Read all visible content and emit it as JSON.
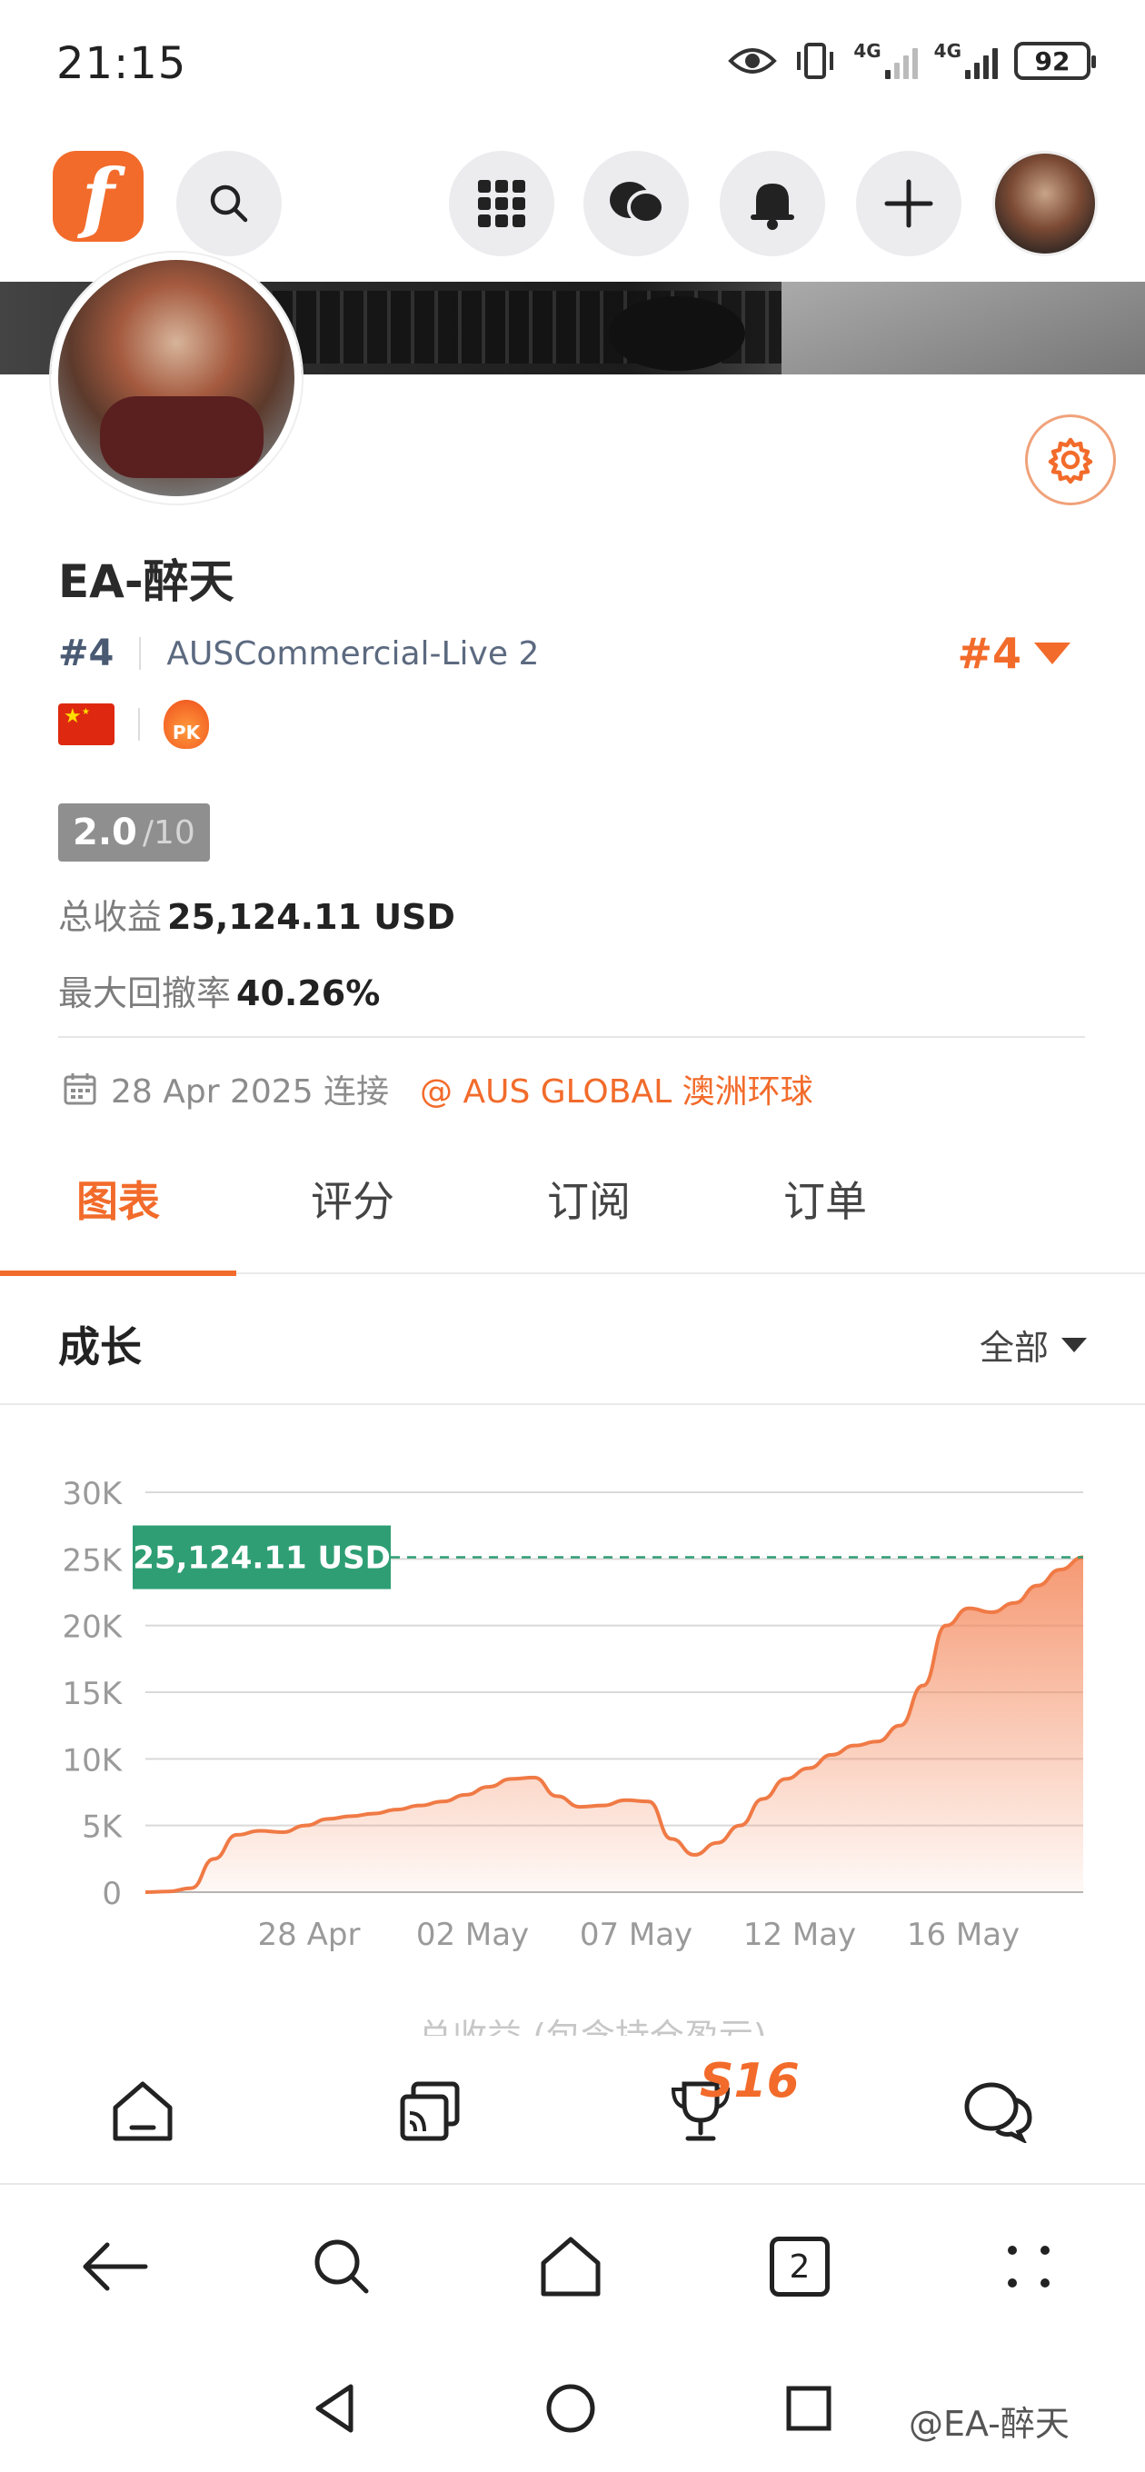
{
  "status_bar": {
    "time": "21:15",
    "network_1": "4G",
    "network_2": "4G",
    "battery": "92"
  },
  "profile": {
    "name": "EA-醉天",
    "rank": "#4",
    "server": "AUSCommercial-Live 2",
    "rank_right": "#4",
    "pk_badge": "PK",
    "score": "2.0",
    "score_max": "/10",
    "total_profit_label": "总收益",
    "total_profit_value": "25,124.11 USD",
    "max_drawdown_label": "最大回撤率",
    "max_drawdown_value": "40.26%",
    "connect_date": "28 Apr 2025 连接",
    "broker": "@ AUS GLOBAL 澳洲环球"
  },
  "tabs": [
    {
      "label": "图表",
      "active": true
    },
    {
      "label": "评分",
      "active": false
    },
    {
      "label": "订阅",
      "active": false
    },
    {
      "label": "订单",
      "active": false
    }
  ],
  "section": {
    "title": "成长",
    "filter": "全部"
  },
  "chart_data": {
    "type": "area",
    "title": "",
    "xlabel": "",
    "ylabel": "",
    "ylim": [
      0,
      30000
    ],
    "y_ticks": [
      "0",
      "5K",
      "10K",
      "15K",
      "20K",
      "25K",
      "30K"
    ],
    "x_ticks": [
      "28 Apr",
      "02 May",
      "07 May",
      "12 May",
      "16 May"
    ],
    "current_value_label": "25,124.11 USD",
    "current_value": 25124.11,
    "series": [
      {
        "values": [
          0,
          50,
          300,
          2500,
          4300,
          4600,
          4500,
          5000,
          5500,
          5700,
          5900,
          6200,
          6500,
          6800,
          7300,
          7900,
          8500,
          8600,
          7200,
          6400,
          6500,
          6900,
          6800,
          4000,
          2800,
          3700,
          5000,
          7000,
          8500,
          9300,
          10300,
          11000,
          11300,
          12500,
          15500,
          20000,
          21300,
          21000,
          21700,
          23000,
          24200,
          25124
        ]
      }
    ],
    "grid": true,
    "fill_color": "#f4875a",
    "line_color": "#f07a45",
    "label_color": "#2f9e74"
  },
  "bottom_cut_label": "总收益 (包含持仓盈亏)",
  "app_nav": {
    "badge": "S16"
  },
  "browser": {
    "tab_count": "2"
  },
  "watermark": "@EA-醉天",
  "colors": {
    "accent": "#f26b2b",
    "label_green": "#2f9e74"
  }
}
